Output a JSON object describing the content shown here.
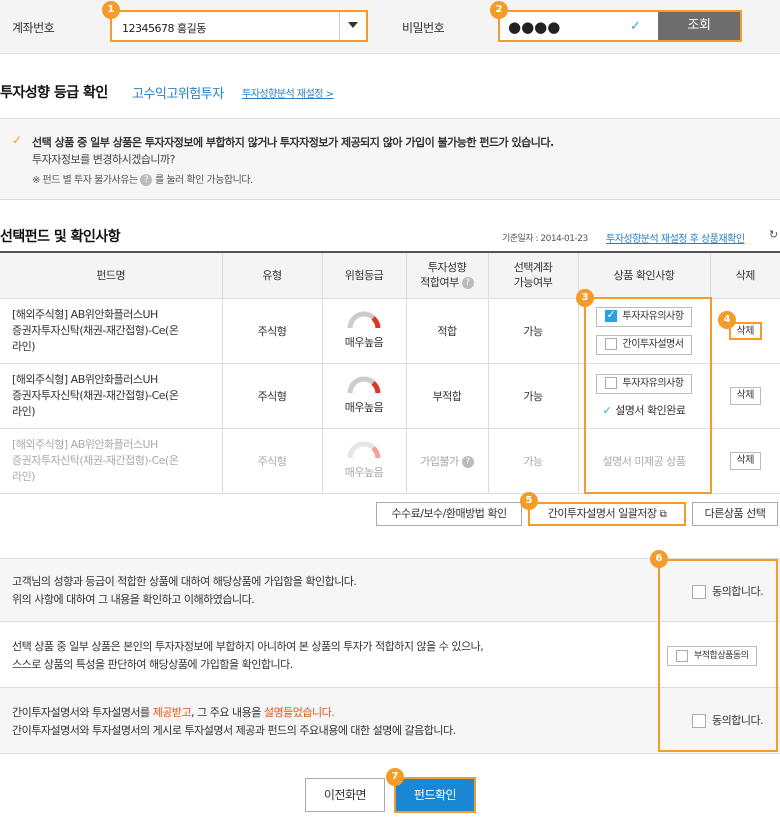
{
  "account": {
    "label": "계좌번호",
    "selected": "12345678 홍길동",
    "password_label": "비밀번호",
    "password_value": "●●●●",
    "lookup_button": "조회"
  },
  "grade": {
    "title": "투자성향 등급 확인",
    "grade_value": "고수익고위험투자",
    "reanalysis_link": "투자성향분석 재설정 >"
  },
  "notice": {
    "line1": "선택 상품 중 일부 상품은 투자자정보에 부합하지 않거나 투자자정보가 제공되지 않아 가입이 불가능한 펀드가 있습니다.",
    "line2": "투자자정보를 변경하시겠습니까?",
    "line3_prefix": "※ 펀드 별 투자 불가사유는",
    "line3_suffix": "를 눌러 확인 가능합니다."
  },
  "fund_section": {
    "title": "선택펀드 및 확인사항",
    "base_date": "기준일자 : 2014-01-23",
    "recheck_link": "투자성향분석 재설정 후 상품재확인"
  },
  "table": {
    "headers": [
      "펀드명",
      "유형",
      "위험등급",
      "투자성향\n적합여부",
      "선택계좌\n가능여부",
      "상품 확인사항",
      "삭제"
    ],
    "rows": [
      {
        "name_l1": "[해외주식형] AB위안화플러스UH",
        "name_l2": "증권자투자신탁(채권-재간접형)-Ce(온",
        "name_l3": "라인)",
        "type": "주식형",
        "risk": "매우높음",
        "fit": "적합",
        "avail": "가능",
        "check1": "투자자유의사항",
        "check2": "간이투자설명서",
        "delete": "삭제"
      },
      {
        "name_l1": "[해외주식형] AB위안화플러스UH",
        "name_l2": "증권자투자신탁(채권-재간접형)-Ce(온",
        "name_l3": "라인)",
        "type": "주식형",
        "risk": "매우높음",
        "fit": "부적합",
        "avail": "가능",
        "check1": "투자자유의사항",
        "check2": "설명서 확인완료",
        "delete": "삭제"
      },
      {
        "name_l1": "[해외주식형] AB위안화플러스UH",
        "name_l2": "증권자투자신탁(채권-재간접형)-Ce(온",
        "name_l3": "라인)",
        "type": "주식형",
        "risk": "매우높음",
        "fit": "가입불가",
        "avail": "가능",
        "check1": "설명서 미제공 상품",
        "delete": "삭제"
      }
    ]
  },
  "actions": {
    "fee_button": "수수료/보수/환매방법 확인",
    "save_all_button": "간이투자설명서 일괄저장",
    "other_button": "다른상품 선택"
  },
  "agreements": {
    "a1_l1": "고객님의 성향과 등급이 적합한 상품에 대하여 해당상품에 가입함을 확인합니다.",
    "a1_l2": "위의 사항에 대하여 그 내용을 확인하고 이해하였습니다.",
    "a1_cb": "동의합니다.",
    "a2_l1": "선택 상품 중 일부 상품은 본인의 투자자정보에 부합하지 아니하여 본 상품의 투자가 적합하지 않을 수 있으나,",
    "a2_l2": "스스로 상품의 특성을 판단하여 해당상품에 가입함을 확인합니다.",
    "a2_cb": "부적합상품동의",
    "a3_l1_a": "간이투자설명서와 투자설명서를 ",
    "a3_l1_b": "제공받고",
    "a3_l1_c": ", 그 주요 내용을 ",
    "a3_l1_d": "설명들었습니다.",
    "a3_l2": "간이투자설명서와 투자설명서의 게시로 투자설명서 제공과 펀드의 주요내용에 대한 설명에 갈음합니다.",
    "a3_cb": "동의합니다."
  },
  "bottom": {
    "prev_button": "이전화면",
    "confirm_button": "펀드확인"
  },
  "badges": [
    "1",
    "2",
    "3",
    "4",
    "5",
    "6",
    "7"
  ],
  "colors": {
    "accent": "#f39c2a",
    "blue": "#2a7fc4",
    "confirm": "#1a86d4",
    "risk": "#e0352b"
  }
}
